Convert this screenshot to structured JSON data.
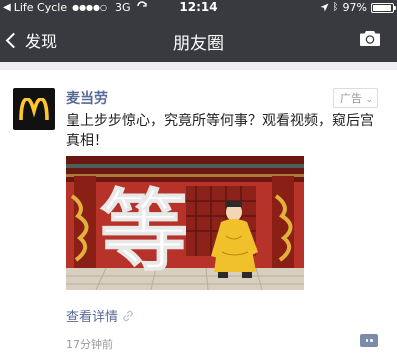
{
  "status_bar": {
    "carrier": "Life Cycle",
    "signal_dots": "●●●●○",
    "network": "3G",
    "time": "12:14",
    "battery_percent": "97%",
    "battery_level": 0.97
  },
  "nav": {
    "back_label": "发现",
    "title": "朋友圈"
  },
  "post": {
    "author": "麦当劳",
    "ad_label": "广告",
    "text": "皇上步步惊心，究竟所等何事？观看视频，窥后宫真相！",
    "image_text": "等",
    "detail_label": "查看详情",
    "time": "17分钟前"
  },
  "colors": {
    "header_bg": "#393a3f",
    "link": "#576b95",
    "mcd_yellow": "#ffc72c",
    "palace_red": "#9e2a1f"
  }
}
